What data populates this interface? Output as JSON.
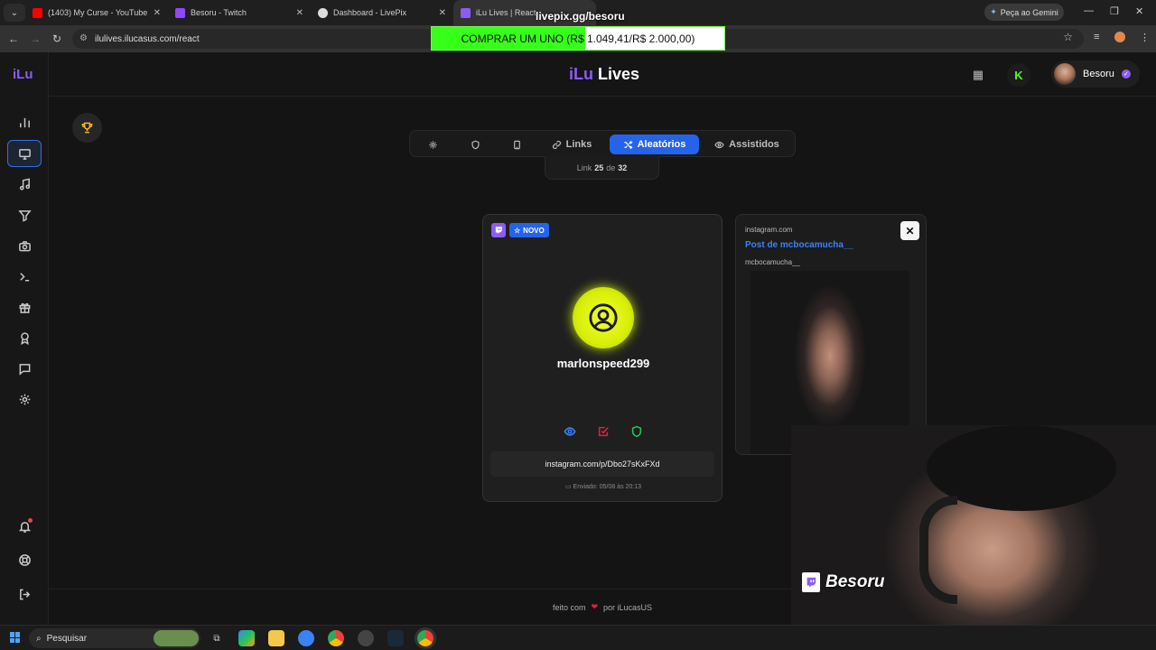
{
  "browser": {
    "tabs": [
      {
        "title": "(1403) My Curse - YouTube",
        "fav_color": "#ff0000"
      },
      {
        "title": "Besoru - Twitch",
        "fav_color": "#9146ff"
      },
      {
        "title": "Dashboard - LivePix",
        "fav_color": "#dddddd"
      },
      {
        "title": "iLu Lives | React",
        "fav_color": "#8b5cf6"
      }
    ],
    "gemini_label": "Peça ao Gemini",
    "url": "ilulives.ilucasus.com/react"
  },
  "overlay": {
    "livepix_title": "livepix.gg/besoru",
    "goal_text": "COMPRAR UM UNO (R$ 1.049,41/R$ 2.000,00)",
    "goal_progress": 0.525
  },
  "sidebar": {
    "logo": "iLu",
    "items": [
      "dashboard",
      "screen",
      "music",
      "filter",
      "camera",
      "terminal",
      "gift",
      "award",
      "chat",
      "settings"
    ]
  },
  "header": {
    "brand_prefix": "iLu",
    "brand_suffix": "Lives",
    "user_name": "Besoru",
    "kick_letter": "K"
  },
  "tabs": {
    "links": "Links",
    "random": "Aleatórios",
    "watched": "Assistidos"
  },
  "counter": {
    "prefix": "Link",
    "current": "25",
    "separator": "de",
    "total": "32"
  },
  "card": {
    "badge_new": "NOVO",
    "username": "marlonspeed299",
    "link": "instagram.com/p/Dbo27sKxFXd",
    "sent": "Enviado: 05/08 às 20:13"
  },
  "preview": {
    "domain": "instagram.com",
    "title": "Post de mcbocamucha__",
    "user": "mcbocamucha__",
    "close": "✕"
  },
  "footer": {
    "text_before": "feito com",
    "heart": "❤",
    "text_after": "por iLucasUS"
  },
  "webcam": {
    "name": "Besoru"
  },
  "taskbar": {
    "search": "Pesquisar"
  }
}
